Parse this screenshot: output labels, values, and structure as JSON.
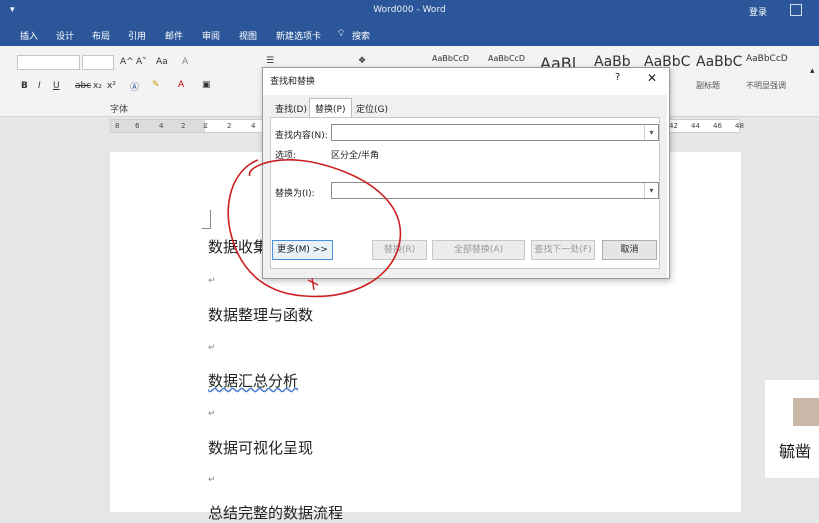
{
  "window": {
    "title": "Word000  -  Word",
    "login": "登录",
    "qat": "▾"
  },
  "tabs": [
    "插入",
    "设计",
    "布局",
    "引用",
    "邮件",
    "审阅",
    "视图",
    "新建选项卡",
    "搜索"
  ],
  "ribbon": {
    "font_group_label": "字体",
    "font_buttons": [
      "A^",
      "A˅",
      "Aa",
      "A"
    ],
    "format_buttons": [
      "B",
      "I",
      "U",
      "abc",
      "x₂",
      "x²"
    ],
    "styles": [
      {
        "preview": "AaBbCcD",
        "name": ""
      },
      {
        "preview": "AaBbCcD",
        "name": ""
      },
      {
        "preview": "AaBl",
        "name": ""
      },
      {
        "preview": "AaBb",
        "name": ""
      },
      {
        "preview": "AaBbC",
        "name": ""
      },
      {
        "preview": "AaBbC",
        "name": "副标题"
      },
      {
        "preview": "AaBbCcD",
        "name": "不明显强调"
      }
    ]
  },
  "ruler": {
    "left_numbers": [
      "8",
      "6",
      "4",
      "2",
      "2",
      "4"
    ],
    "right_numbers": [
      "42",
      "44",
      "46",
      "48"
    ]
  },
  "document": {
    "lines": [
      "数据收集",
      "数据整理与函数",
      "数据汇总分析",
      "数据可视化呈现",
      "总结完整的数据流程"
    ],
    "paragraph_mark": "↵"
  },
  "dialog": {
    "title": "查找和替换",
    "help": "?",
    "close": "✕",
    "tabs": [
      "查找(D)",
      "替换(P)",
      "定位(G)"
    ],
    "find_label": "查找内容(N):",
    "find_value": "",
    "options_label": "选项:",
    "options_value": "区分全/半角",
    "replace_label": "替换为(I):",
    "replace_value": "",
    "buttons": {
      "more": "更多(M) >>",
      "replace": "替换(R)",
      "replace_all": "全部替换(A)",
      "find_next": "查找下一处(F)",
      "cancel": "取消"
    }
  },
  "thumbnail": {
    "text": "毓凿"
  },
  "colors": {
    "accent": "#2b579a",
    "annotation": "#cc1f1f"
  }
}
